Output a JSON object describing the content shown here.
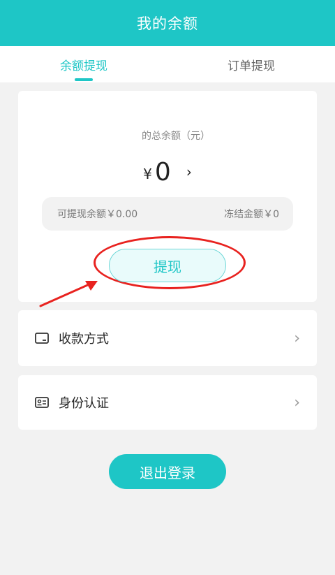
{
  "header": {
    "title": "我的余额"
  },
  "tabs": [
    {
      "label": "余额提现",
      "active": true
    },
    {
      "label": "订单提现",
      "active": false
    }
  ],
  "balance": {
    "label": "的总余额（元）",
    "currency": "¥",
    "amount": "0",
    "chevron": "›",
    "withdrawable": "可提现余额￥0.00",
    "frozen": "冻结金额￥0"
  },
  "withdraw_button": {
    "label": "提现"
  },
  "menu": [
    {
      "label": "收款方式",
      "icon": "card-icon"
    },
    {
      "label": "身份认证",
      "icon": "id-card-icon"
    }
  ],
  "menu_chevron": "›",
  "logout_button": {
    "label": "退出登录"
  },
  "colors": {
    "primary": "#1ec6c6",
    "annotation": "#e8221f",
    "background": "#f2f2f2"
  }
}
